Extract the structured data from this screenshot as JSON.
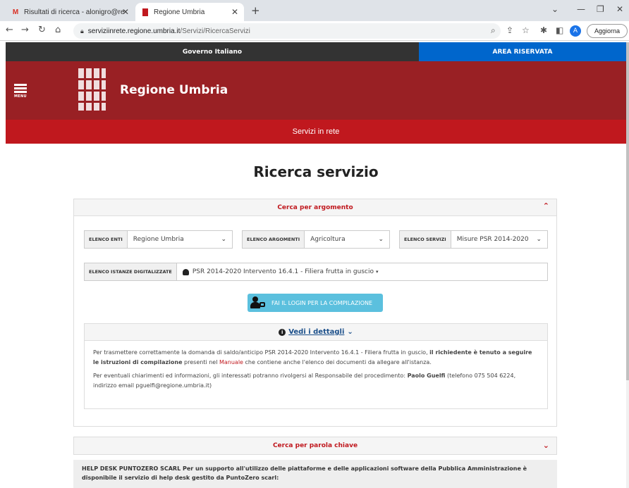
{
  "browser": {
    "tabs": [
      {
        "label": "Risultati di ricerca - alonigro@re",
        "icon": "gmail-icon"
      },
      {
        "label": "Regione Umbria",
        "icon": "regione-favicon"
      }
    ],
    "url_host": "serviziinrete.regione.umbria.it",
    "url_path": "/Servizi/RicercaServizi",
    "avatar_letter": "A",
    "update_label": "Aggiorna"
  },
  "header": {
    "gov_label": "Governo Italiano",
    "area_label": "AREA RISERVATA",
    "menu_label": "MENU",
    "site_title": "Regione Umbria",
    "services_bar": "Servizi in rete"
  },
  "page_title": "Ricerca servizio",
  "search_by_topic": {
    "header": "Cerca per argomento",
    "enti": {
      "label": "ELENCO ENTI",
      "value": "Regione Umbria"
    },
    "argomenti": {
      "label": "ELENCO ARGOMENTI",
      "value": "Agricoltura"
    },
    "servizi": {
      "label": "ELENCO SERVIZI",
      "value": "Misure PSR 2014-2020"
    },
    "istanze": {
      "label": "ELENCO ISTANZE DIGITALIZZATE",
      "value": "PSR 2014-2020 Intervento 16.4.1 - Filiera frutta in guscio"
    },
    "login_button": "FAI IL LOGIN PER LA COMPILAZIONE",
    "details": {
      "header": "Vedi i dettagli",
      "p1_a": "Per trasmettere correttamente la domanda di saldo/anticipo PSR 2014-2020 Intervento 16.4.1 - Filiera frutta in guscio, ",
      "p1_b": "il richiedente è tenuto a seguire le istruzioni di compilazione",
      "p1_c": " presenti nel ",
      "p1_link": "Manuale",
      "p1_d": " che contiene anche l'elenco dei documenti da allegare all'istanza.",
      "p2_a": "Per eventuali chiarimenti ed informazioni, gli interessati potranno rivolgersi al Responsabile del procedimento: ",
      "p2_b": "Paolo Guelfi",
      "p2_c": " (telefono 075 504 6224, indirizzo email pguelfi@regione.umbria.it)"
    }
  },
  "search_by_keyword": {
    "header": "Cerca per parola chiave"
  },
  "helpdesk": {
    "text": "HELP DESK PUNTOZERO SCARL Per un supporto all'utilizzo delle piattaforme e delle applicazioni software della Pubblica Amministrazione è disponibile il servizio di help desk gestito da PuntoZero scarl:"
  }
}
